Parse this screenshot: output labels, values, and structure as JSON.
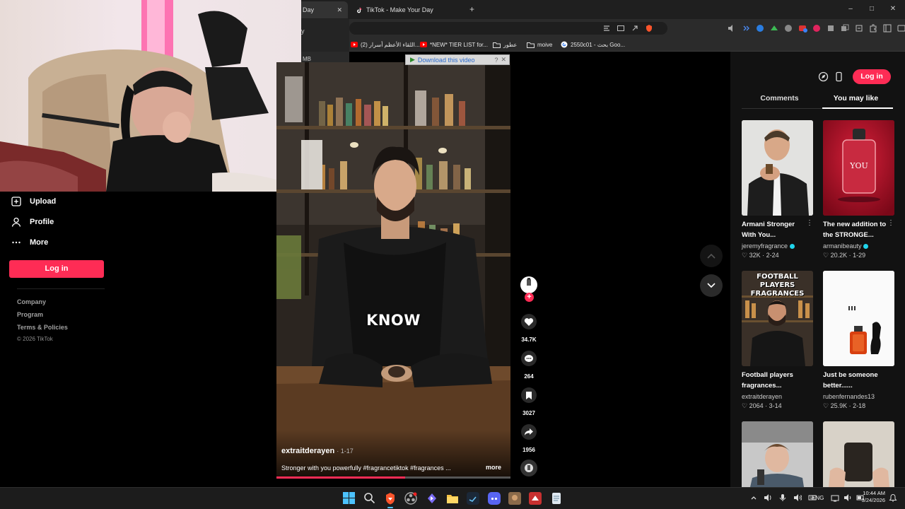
{
  "browser": {
    "tabs": [
      {
        "label": "Day",
        "active": true
      },
      {
        "label": "TikTok - Make Your Day",
        "active": false
      }
    ],
    "new_tab": "+",
    "controls": {
      "minimize": "–",
      "maximize": "□",
      "close": "✕"
    },
    "bookmarks": [
      {
        "label": "(2) اللقاء الأعظم أسرار...",
        "icon": "youtube-icon"
      },
      {
        "label": "*NEW* TIER LIST for...",
        "icon": "youtube-icon"
      },
      {
        "label": "عطور",
        "icon": "folder-icon"
      },
      {
        "label": "moive",
        "icon": "folder-icon"
      },
      {
        "label": "2550c01 - بحث Goo...",
        "icon": "google-icon"
      }
    ],
    "download_bar": "Download this video",
    "download_help": "?",
    "download_close": "✕",
    "side_label_1": "y",
    "side_label_2": "MB"
  },
  "sidebar": {
    "items": [
      {
        "label": "Upload",
        "icon": "upload-icon"
      },
      {
        "label": "Profile",
        "icon": "profile-icon"
      },
      {
        "label": "More",
        "icon": "more-icon"
      }
    ],
    "login": "Log in",
    "footer": [
      "Company",
      "Program",
      "Terms & Policies",
      "© 2026 TikTok"
    ]
  },
  "video": {
    "overlay_text": "KNOW",
    "author": "extraitderayen",
    "date": "1-17",
    "caption": "Stronger with you powerfully #fragrancetiktok #fragrances ...",
    "more": "more",
    "progress": 0.55,
    "actions": {
      "likes": "34.7K",
      "comments": "264",
      "saves": "3027",
      "shares": "1956"
    },
    "avatar_label": "ExtraitDerayen"
  },
  "right_panel": {
    "login": "Log in",
    "tabs": [
      {
        "label": "Comments",
        "active": false
      },
      {
        "label": "You may like",
        "active": true
      }
    ],
    "cards": [
      {
        "title": "Armani Stronger With You...",
        "author": "jeremyfragrance",
        "verified": true,
        "likes": "32K",
        "date": "2-24"
      },
      {
        "title": "The new addition to the STRONGE...",
        "author": "armanibeauty",
        "verified": true,
        "likes": "20.2K",
        "date": "1-29"
      },
      {
        "title": "Football players fragrances...",
        "author": "extraitderayen",
        "verified": false,
        "likes": "2064",
        "date": "3-14"
      },
      {
        "title": "Just be someone better......",
        "author": "rubenfernandes13",
        "verified": false,
        "likes": "25.9K",
        "date": "2-18"
      }
    ],
    "thumb_text_3": "FOOTBALL PLAYERS FRAGRANCES",
    "thumb_text_2": "YOU"
  },
  "taskbar": {
    "lang": "ENG",
    "time": "10:44 AM",
    "date": "3/24/2026"
  }
}
